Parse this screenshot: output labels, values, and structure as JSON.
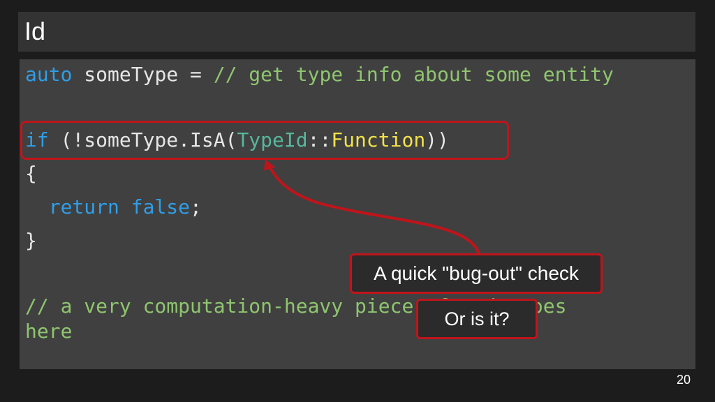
{
  "slide": {
    "title": "Id",
    "page_number": "20"
  },
  "code": {
    "line1": {
      "kw": "auto",
      "plain": " someType = ",
      "comment": "// get type info about some entity"
    },
    "line3": {
      "kw": "if",
      "open": " (!someType.IsA(",
      "type": "TypeId",
      "sep": "::",
      "fn": "Function",
      "close": "))"
    },
    "line4": "{",
    "line5": {
      "indent": "  ",
      "kw_return": "return",
      "space": " ",
      "kw_false": "false",
      "semi": ";"
    },
    "line6": "}",
    "line8": "// a very computation-heavy piece of code goes",
    "line9": "here"
  },
  "callouts": {
    "first": "A quick \"bug-out\" check",
    "second": "Or is it?"
  },
  "colors": {
    "keyword": "#2f9ee8",
    "comment": "#8fc56f",
    "type": "#56b79c",
    "function": "#f2e24a",
    "highlight": "#c0141b"
  }
}
